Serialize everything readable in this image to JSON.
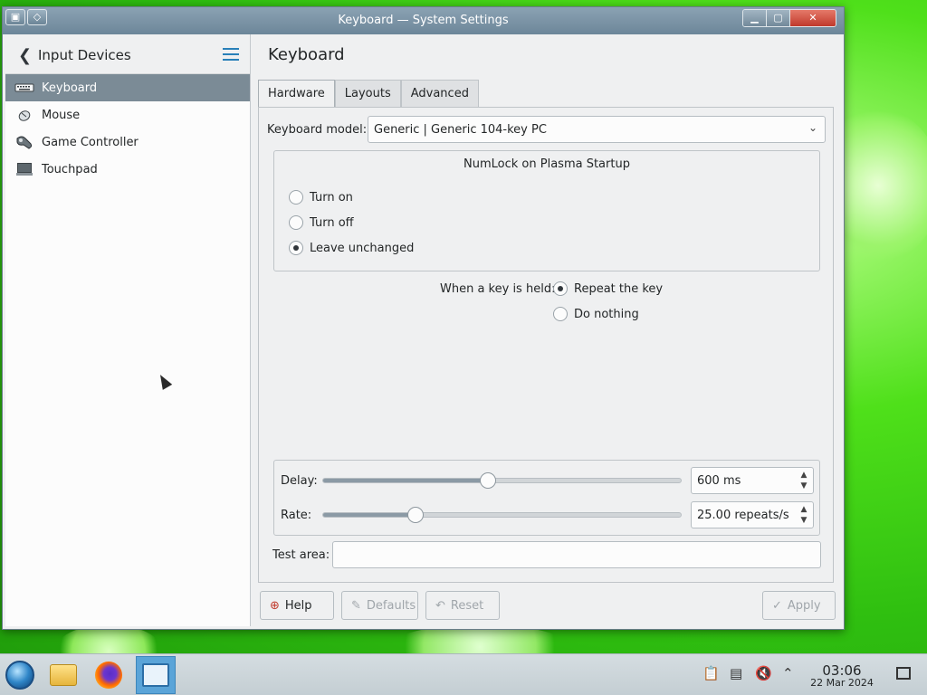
{
  "window": {
    "title": "Keyboard — System Settings"
  },
  "sidebar": {
    "header": "Input Devices",
    "items": [
      {
        "label": "Keyboard",
        "icon": "keyboard-icon",
        "active": true
      },
      {
        "label": "Mouse",
        "icon": "mouse-icon",
        "active": false
      },
      {
        "label": "Game Controller",
        "icon": "game-controller-icon",
        "active": false
      },
      {
        "label": "Touchpad",
        "icon": "touchpad-icon",
        "active": false
      }
    ]
  },
  "main": {
    "title": "Keyboard",
    "tabs": [
      {
        "label": "Hardware",
        "active": true
      },
      {
        "label": "Layouts",
        "active": false
      },
      {
        "label": "Advanced",
        "active": false
      }
    ],
    "keyboard_model": {
      "label": "Keyboard model:",
      "value": "Generic | Generic 104-key PC"
    },
    "numlock": {
      "title": "NumLock on Plasma Startup",
      "options": [
        {
          "label": "Turn on",
          "checked": false
        },
        {
          "label": "Turn off",
          "checked": false
        },
        {
          "label": "Leave unchanged",
          "checked": true
        }
      ]
    },
    "key_held": {
      "label": "When a key is held:",
      "options": [
        {
          "label": "Repeat the key",
          "checked": true
        },
        {
          "label": "Do nothing",
          "checked": false
        }
      ]
    },
    "delay": {
      "label": "Delay:",
      "value": "600 ms",
      "slider_fraction": 0.46
    },
    "rate": {
      "label": "Rate:",
      "value": "25.00 repeats/s",
      "slider_fraction": 0.26
    },
    "test_area": {
      "label": "Test area:",
      "value": ""
    }
  },
  "footer": {
    "help": "Help",
    "defaults": "Defaults",
    "reset": "Reset",
    "apply": "Apply"
  },
  "taskbar": {
    "time": "03:06",
    "date": "22 Mar 2024"
  }
}
